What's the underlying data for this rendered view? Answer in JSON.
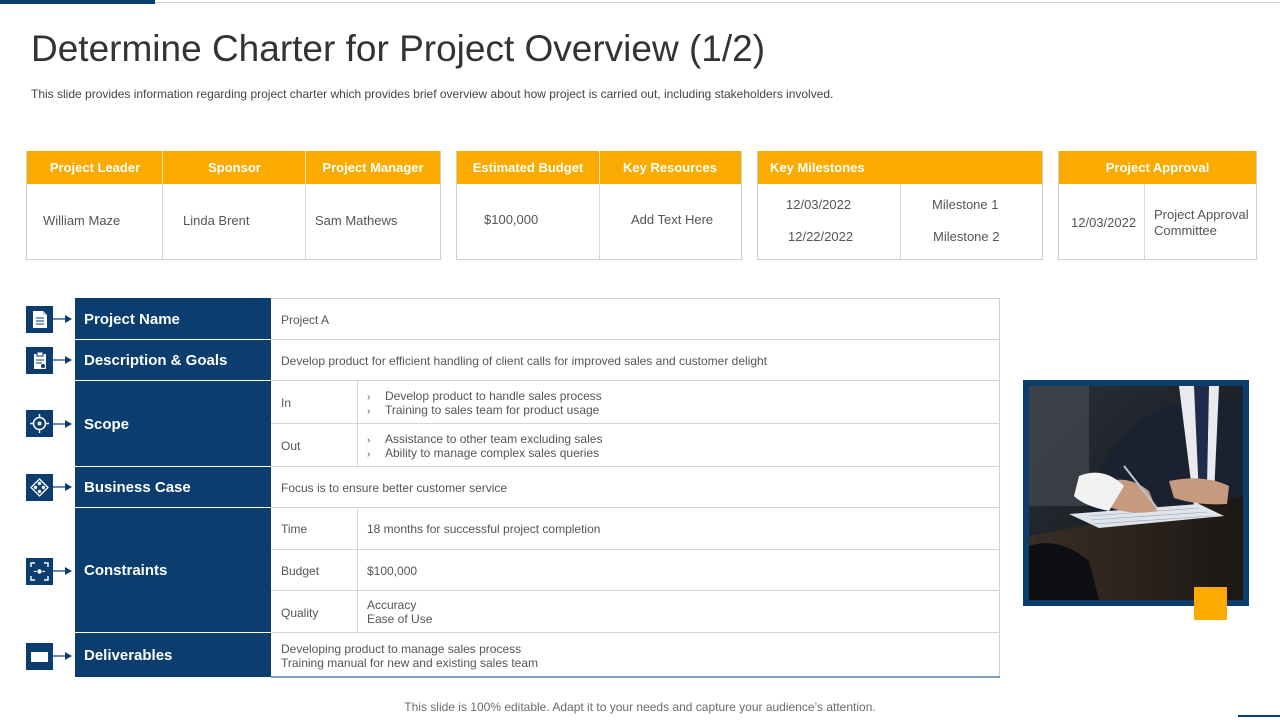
{
  "slide": {
    "title": "Determine Charter for Project Overview (1/2)",
    "subtitle": "This slide provides information regarding project charter which provides brief overview about how project is carried out, including stakeholders involved.",
    "footer": "This slide is 100% editable. Adapt it to your needs and capture your audience’s attention."
  },
  "colors": {
    "navy": "#0b3d6e",
    "amber": "#fbab00"
  },
  "people": {
    "headers": [
      "Project Leader",
      "Sponsor",
      "Project Manager"
    ],
    "values": [
      "William Maze",
      "Linda Brent",
      "Sam Mathews"
    ]
  },
  "budget": {
    "headers": [
      "Estimated Budget",
      "Key Resources"
    ],
    "values": [
      "$100,000",
      "Add Text Here"
    ]
  },
  "milestones": {
    "header": "Key Milestones",
    "rows": [
      {
        "date": "12/03/2022",
        "name": "Milestone 1"
      },
      {
        "date": "12/22/2022",
        "name": "Milestone 2"
      }
    ]
  },
  "approval": {
    "header": "Project Approval",
    "date": "12/03/2022",
    "by_line1": "Project Approval",
    "by_line2": "Committee"
  },
  "charter": {
    "project_name": {
      "label": "Project Name",
      "value": "Project A",
      "icon": "document-icon"
    },
    "description": {
      "label": "Description & Goals",
      "value": "Develop product for efficient handling of client calls for improved sales and customer delight",
      "icon": "clipboard-icon"
    },
    "scope": {
      "label": "Scope",
      "icon": "target-icon",
      "in_label": "In",
      "in_items": [
        "Develop product to handle sales process",
        "Training to sales team for product usage"
      ],
      "out_label": "Out",
      "out_items": [
        "Assistance to other team excluding sales",
        "Ability to manage complex sales queries"
      ]
    },
    "business_case": {
      "label": "Business Case",
      "value": "Focus is to ensure better customer service",
      "icon": "network-icon"
    },
    "constraints": {
      "label": "Constraints",
      "icon": "focus-icon",
      "time_label": "Time",
      "time_value": "18 months for successful project completion",
      "budget_label": "Budget",
      "budget_value": "$100,000",
      "quality_label": "Quality",
      "quality_values": [
        "Accuracy",
        "Ease of Use"
      ]
    },
    "deliverables": {
      "label": "Deliverables",
      "icon": "rectangle-icon",
      "values": [
        "Developing product to manage sales process",
        "Training manual for new and existing sales team"
      ]
    }
  },
  "image": {
    "subject": "businessman-signing-document-photo"
  }
}
